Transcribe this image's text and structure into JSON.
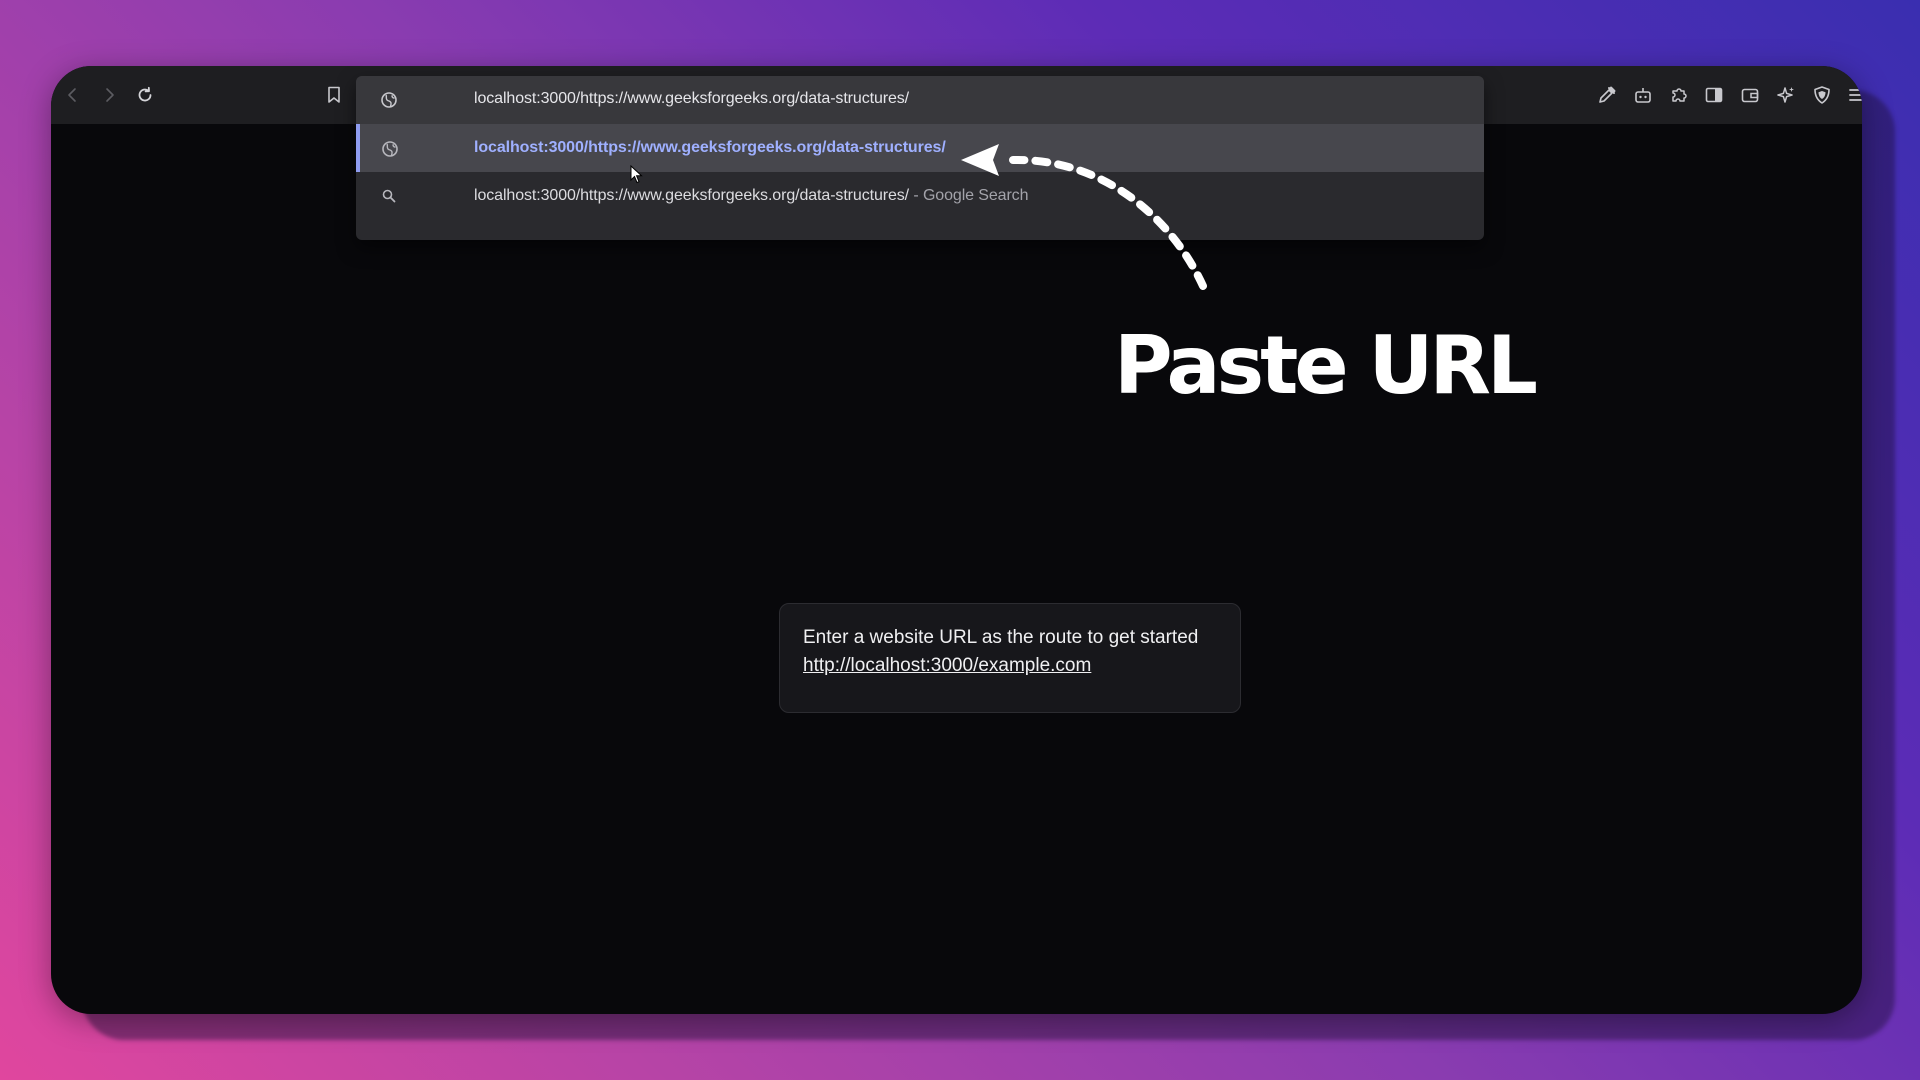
{
  "browser": {
    "address_bar": {
      "value": "localhost:3000/https://www.geeksforgeeks.org/data-structures/"
    },
    "suggestions": [
      {
        "icon": "globe-icon",
        "text": "localhost:3000/https://www.geeksforgeeks.org/data-structures/"
      },
      {
        "icon": "search-icon",
        "text": "localhost:3000/https://www.geeksforgeeks.org/data-structures/",
        "suffix": " - Google Search"
      }
    ],
    "toolbar_icons": [
      "back-icon",
      "forward-icon",
      "reload-icon",
      "bookmark-icon",
      "eyedropper-icon",
      "robot-icon",
      "puzzle-icon",
      "sidebar-icon",
      "wallet-icon",
      "sparkle-icon",
      "shield-icon",
      "menu-icon"
    ]
  },
  "overlay": {
    "headline": "Paste URL"
  },
  "page": {
    "message": "Enter a website URL as the route to get started",
    "example_link": "http://localhost:3000/example.com"
  },
  "colors": {
    "background_start": "#e0469e",
    "background_end": "#3a2eb0",
    "browser_bg": "#08080b",
    "toolbar_bg": "#1e1e21",
    "highlight_text": "#9fb0ff"
  }
}
